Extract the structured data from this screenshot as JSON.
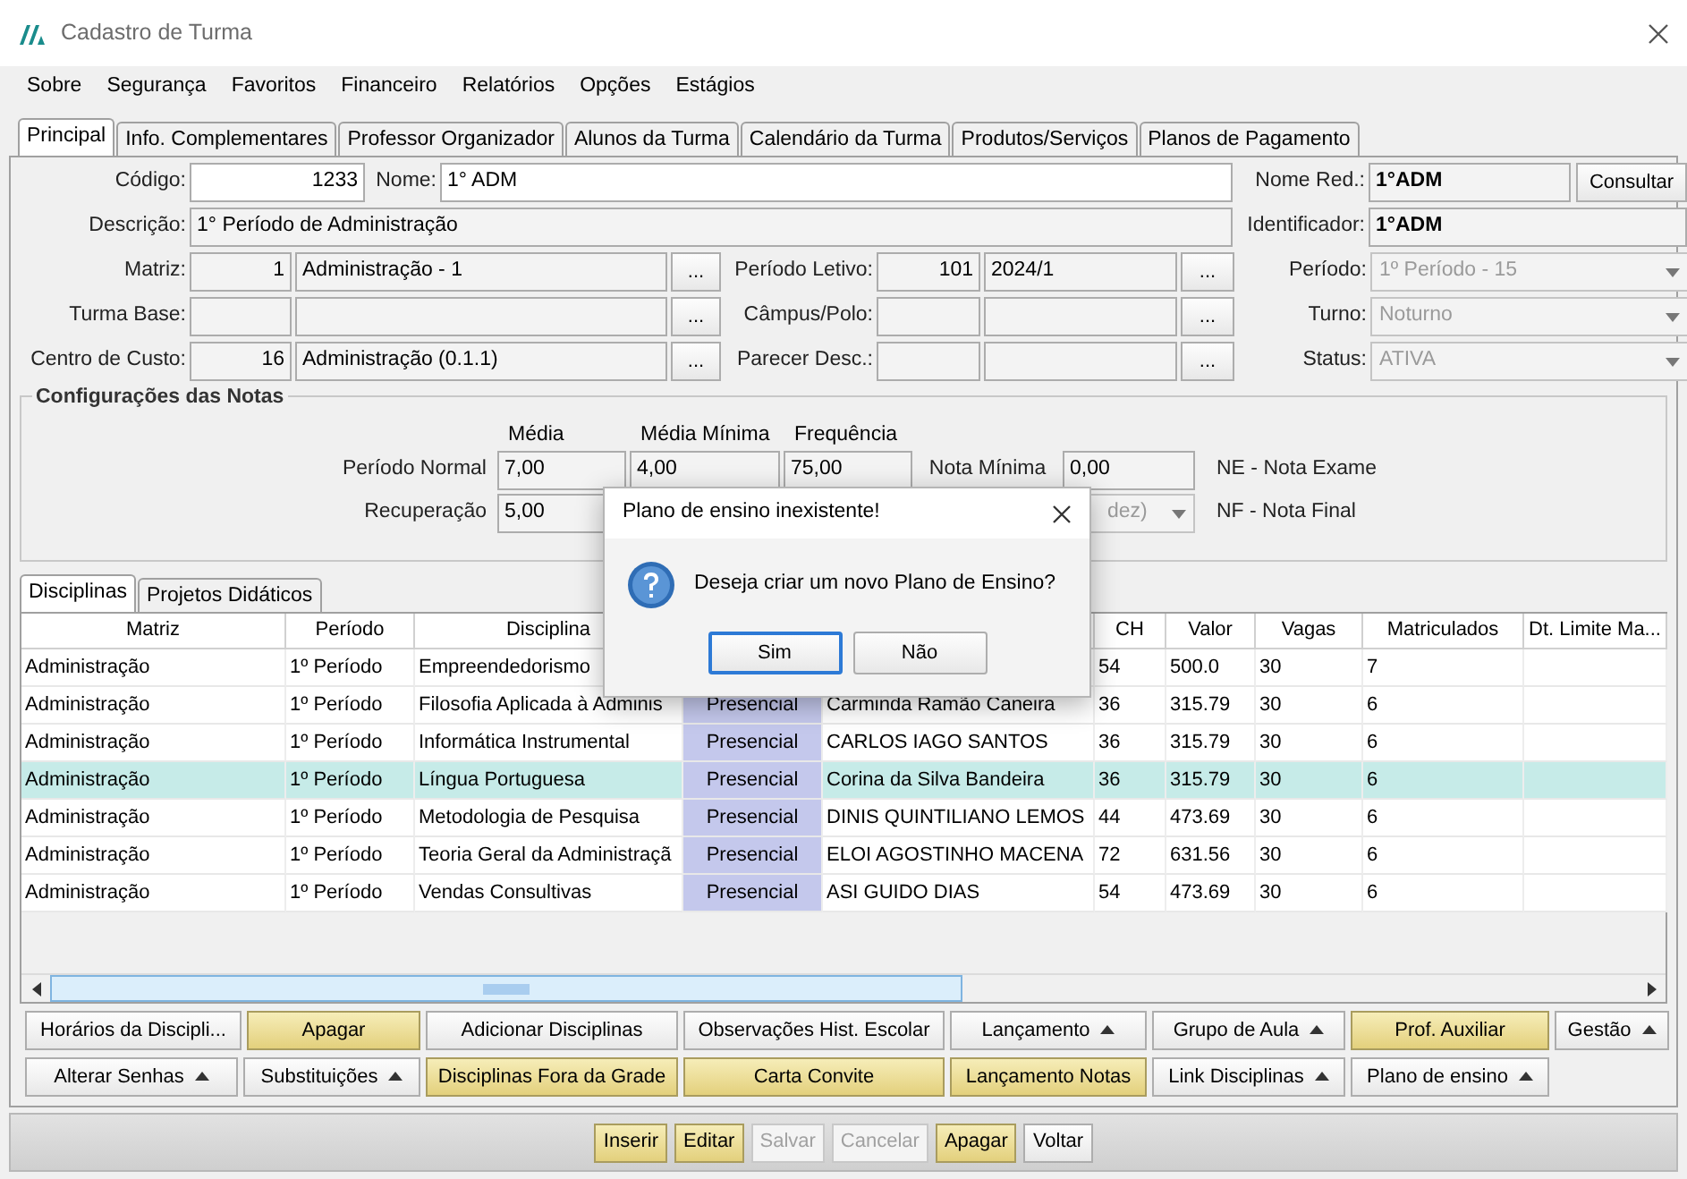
{
  "window": {
    "title": "Cadastro de Turma"
  },
  "menu": [
    "Sobre",
    "Segurança",
    "Favoritos",
    "Financeiro",
    "Relatórios",
    "Opções",
    "Estágios"
  ],
  "tabs": [
    {
      "label": "Principal",
      "selected": true
    },
    {
      "label": "Info. Complementares",
      "selected": false
    },
    {
      "label": "Professor Organizador",
      "selected": false
    },
    {
      "label": "Alunos da Turma",
      "selected": false
    },
    {
      "label": "Calendário da Turma",
      "selected": false
    },
    {
      "label": "Produtos/Serviços",
      "selected": false
    },
    {
      "label": "Planos de Pagamento",
      "selected": false
    }
  ],
  "form": {
    "rows": [
      {
        "items": [
          {
            "kind": "label",
            "text": "Código:"
          },
          {
            "kind": "num-field",
            "value": "1233",
            "editable": true
          },
          {
            "kind": "label",
            "text": "Nome:"
          },
          {
            "kind": "field",
            "value": "1° ADM",
            "editable": true
          },
          {
            "kind": "label",
            "text": "Nome Red.:"
          },
          {
            "kind": "field",
            "value": "1°ADM",
            "bold": true
          },
          {
            "kind": "button",
            "text": "Consultar"
          }
        ]
      },
      {
        "items": [
          {
            "kind": "label",
            "text": "Descrição:"
          },
          {
            "kind": "field",
            "value": "1° Período de Administração"
          },
          {
            "kind": "label",
            "text": "Identificador:"
          },
          {
            "kind": "field",
            "value": "1°ADM",
            "bold": true
          }
        ]
      },
      {
        "items": [
          {
            "kind": "label",
            "text": "Matriz:"
          },
          {
            "kind": "num-field",
            "value": "1"
          },
          {
            "kind": "field",
            "value": "Administração - 1"
          },
          {
            "kind": "button",
            "text": "..."
          },
          {
            "kind": "label",
            "text": "Período Letivo:"
          },
          {
            "kind": "num-field",
            "value": "101"
          },
          {
            "kind": "field",
            "value": "2024/1"
          },
          {
            "kind": "button",
            "text": "..."
          },
          {
            "kind": "label",
            "text": "Período:"
          },
          {
            "kind": "select",
            "value": "1º Período - 15",
            "disabled": true
          }
        ]
      },
      {
        "items": [
          {
            "kind": "label",
            "text": "Turma Base:"
          },
          {
            "kind": "num-field"
          },
          {
            "kind": "field"
          },
          {
            "kind": "button",
            "text": "..."
          },
          {
            "kind": "label",
            "text": "Câmpus/Polo:"
          },
          {
            "kind": "num-field"
          },
          {
            "kind": "field"
          },
          {
            "kind": "button",
            "text": "..."
          },
          {
            "kind": "label",
            "text": "Turno:"
          },
          {
            "kind": "select",
            "value": "Noturno",
            "disabled": true
          }
        ]
      },
      {
        "items": [
          {
            "kind": "label",
            "text": "Centro de Custo:"
          },
          {
            "kind": "num-field",
            "value": "16"
          },
          {
            "kind": "field",
            "value": "Administração (0.1.1)"
          },
          {
            "kind": "button",
            "text": "..."
          },
          {
            "kind": "label",
            "text": "Parecer Desc.:"
          },
          {
            "kind": "num-field"
          },
          {
            "kind": "field"
          },
          {
            "kind": "button",
            "text": "..."
          },
          {
            "kind": "label",
            "text": "Status:"
          },
          {
            "kind": "select",
            "value": "ATIVA",
            "disabled": true
          }
        ]
      }
    ]
  },
  "notes": {
    "title": "Configurações das Notas",
    "columns": [
      "Média",
      "Média Mínima",
      "Frequência"
    ],
    "rows": [
      {
        "label": "Período Normal",
        "values": [
          "7,00",
          "4,00",
          "75,00"
        ],
        "extra": {
          "kind": "field",
          "label": "Nota Mínima",
          "value": "0,00"
        },
        "legend": "NE - Nota Exame"
      },
      {
        "label": "Recuperação",
        "values": [
          "5,00"
        ],
        "extra": {
          "kind": "select",
          "value": "dez)",
          "disabled": true
        },
        "legend": "NF - Nota Final"
      }
    ]
  },
  "subtabs": [
    {
      "label": "Disciplinas",
      "selected": true
    },
    {
      "label": "Projetos Didáticos",
      "selected": false
    }
  ],
  "table": {
    "columns": [
      "Matriz",
      "Período",
      "Disciplina",
      null,
      null,
      "CH",
      "Valor",
      "Vagas",
      "Matriculados",
      "Dt. Limite Ma..."
    ],
    "rows": [
      {
        "selected": false,
        "cells": [
          "Administração",
          "1º Período",
          "Empreendedorismo",
          null,
          null,
          "54",
          "500.0",
          "30",
          "7",
          null
        ]
      },
      {
        "selected": false,
        "cells": [
          "Administração",
          "1º Período",
          "Filosofia Aplicada à Adminis",
          "Presencial",
          "Carminda Ramão Caneira",
          "36",
          "315.79",
          "30",
          "6",
          null
        ]
      },
      {
        "selected": false,
        "cells": [
          "Administração",
          "1º Período",
          "Informática Instrumental",
          "Presencial",
          "CARLOS IAGO SANTOS",
          "36",
          "315.79",
          "30",
          "6",
          null
        ]
      },
      {
        "selected": true,
        "cells": [
          "Administração",
          "1º Período",
          "Língua Portuguesa",
          "Presencial",
          "Corina da Silva Bandeira",
          "36",
          "315.79",
          "30",
          "6",
          null
        ]
      },
      {
        "selected": false,
        "cells": [
          "Administração",
          "1º Período",
          "Metodologia de Pesquisa",
          "Presencial",
          "DINIS QUINTILIANO LEMOS",
          "44",
          "473.69",
          "30",
          "6",
          null
        ]
      },
      {
        "selected": false,
        "cells": [
          "Administração",
          "1º Período",
          "Teoria Geral da Administraçã",
          "Presencial",
          "ELOI AGOSTINHO MACENA",
          "72",
          "631.56",
          "30",
          "6",
          null
        ]
      },
      {
        "selected": false,
        "cells": [
          "Administração",
          "1º Período",
          "Vendas Consultivas",
          "Presencial",
          "ASI GUIDO DIAS",
          "54",
          "473.69",
          "30",
          "6",
          null
        ]
      }
    ]
  },
  "actions": [
    [
      {
        "label": "Horários da Discipli...",
        "highlighted": false,
        "dropdown": false
      },
      {
        "label": "Apagar",
        "highlighted": true,
        "dropdown": false
      },
      {
        "label": "Adicionar Disciplinas",
        "highlighted": false,
        "dropdown": false
      },
      {
        "label": "Observações Hist. Escolar",
        "highlighted": false,
        "dropdown": false
      },
      {
        "label": "Lançamento",
        "highlighted": false,
        "dropdown": true
      },
      {
        "label": "Grupo de Aula",
        "highlighted": false,
        "dropdown": true
      },
      {
        "label": "Prof. Auxiliar",
        "highlighted": true,
        "dropdown": false
      },
      {
        "label": "Gestão",
        "highlighted": false,
        "dropdown": true
      }
    ],
    [
      {
        "label": "Alterar Senhas",
        "highlighted": false,
        "dropdown": true
      },
      {
        "label": "Substituições",
        "highlighted": false,
        "dropdown": true
      },
      {
        "label": "Disciplinas Fora da Grade",
        "highlighted": true,
        "dropdown": false
      },
      {
        "label": "Carta Convite",
        "highlighted": true,
        "dropdown": false
      },
      {
        "label": "Lançamento Notas",
        "highlighted": true,
        "dropdown": false
      },
      {
        "label": "Link Disciplinas",
        "highlighted": false,
        "dropdown": true
      },
      {
        "label": "Plano de ensino",
        "highlighted": false,
        "dropdown": true
      }
    ]
  ],
  "footer": [
    {
      "label": "Inserir",
      "highlighted": true,
      "disabled": false
    },
    {
      "label": "Editar",
      "highlighted": true,
      "disabled": false
    },
    {
      "label": "Salvar",
      "highlighted": false,
      "disabled": true
    },
    {
      "label": "Cancelar",
      "highlighted": false,
      "disabled": true
    },
    {
      "label": "Apagar",
      "highlighted": true,
      "disabled": false
    },
    {
      "label": "Voltar",
      "highlighted": false,
      "disabled": false
    }
  ],
  "dialog": {
    "title": "Plano de ensino inexistente!",
    "message": "Deseja criar um novo Plano de Ensino?",
    "buttons": [
      {
        "label": "Sim",
        "selected": true
      },
      {
        "label": "Não",
        "selected": false
      }
    ]
  }
}
